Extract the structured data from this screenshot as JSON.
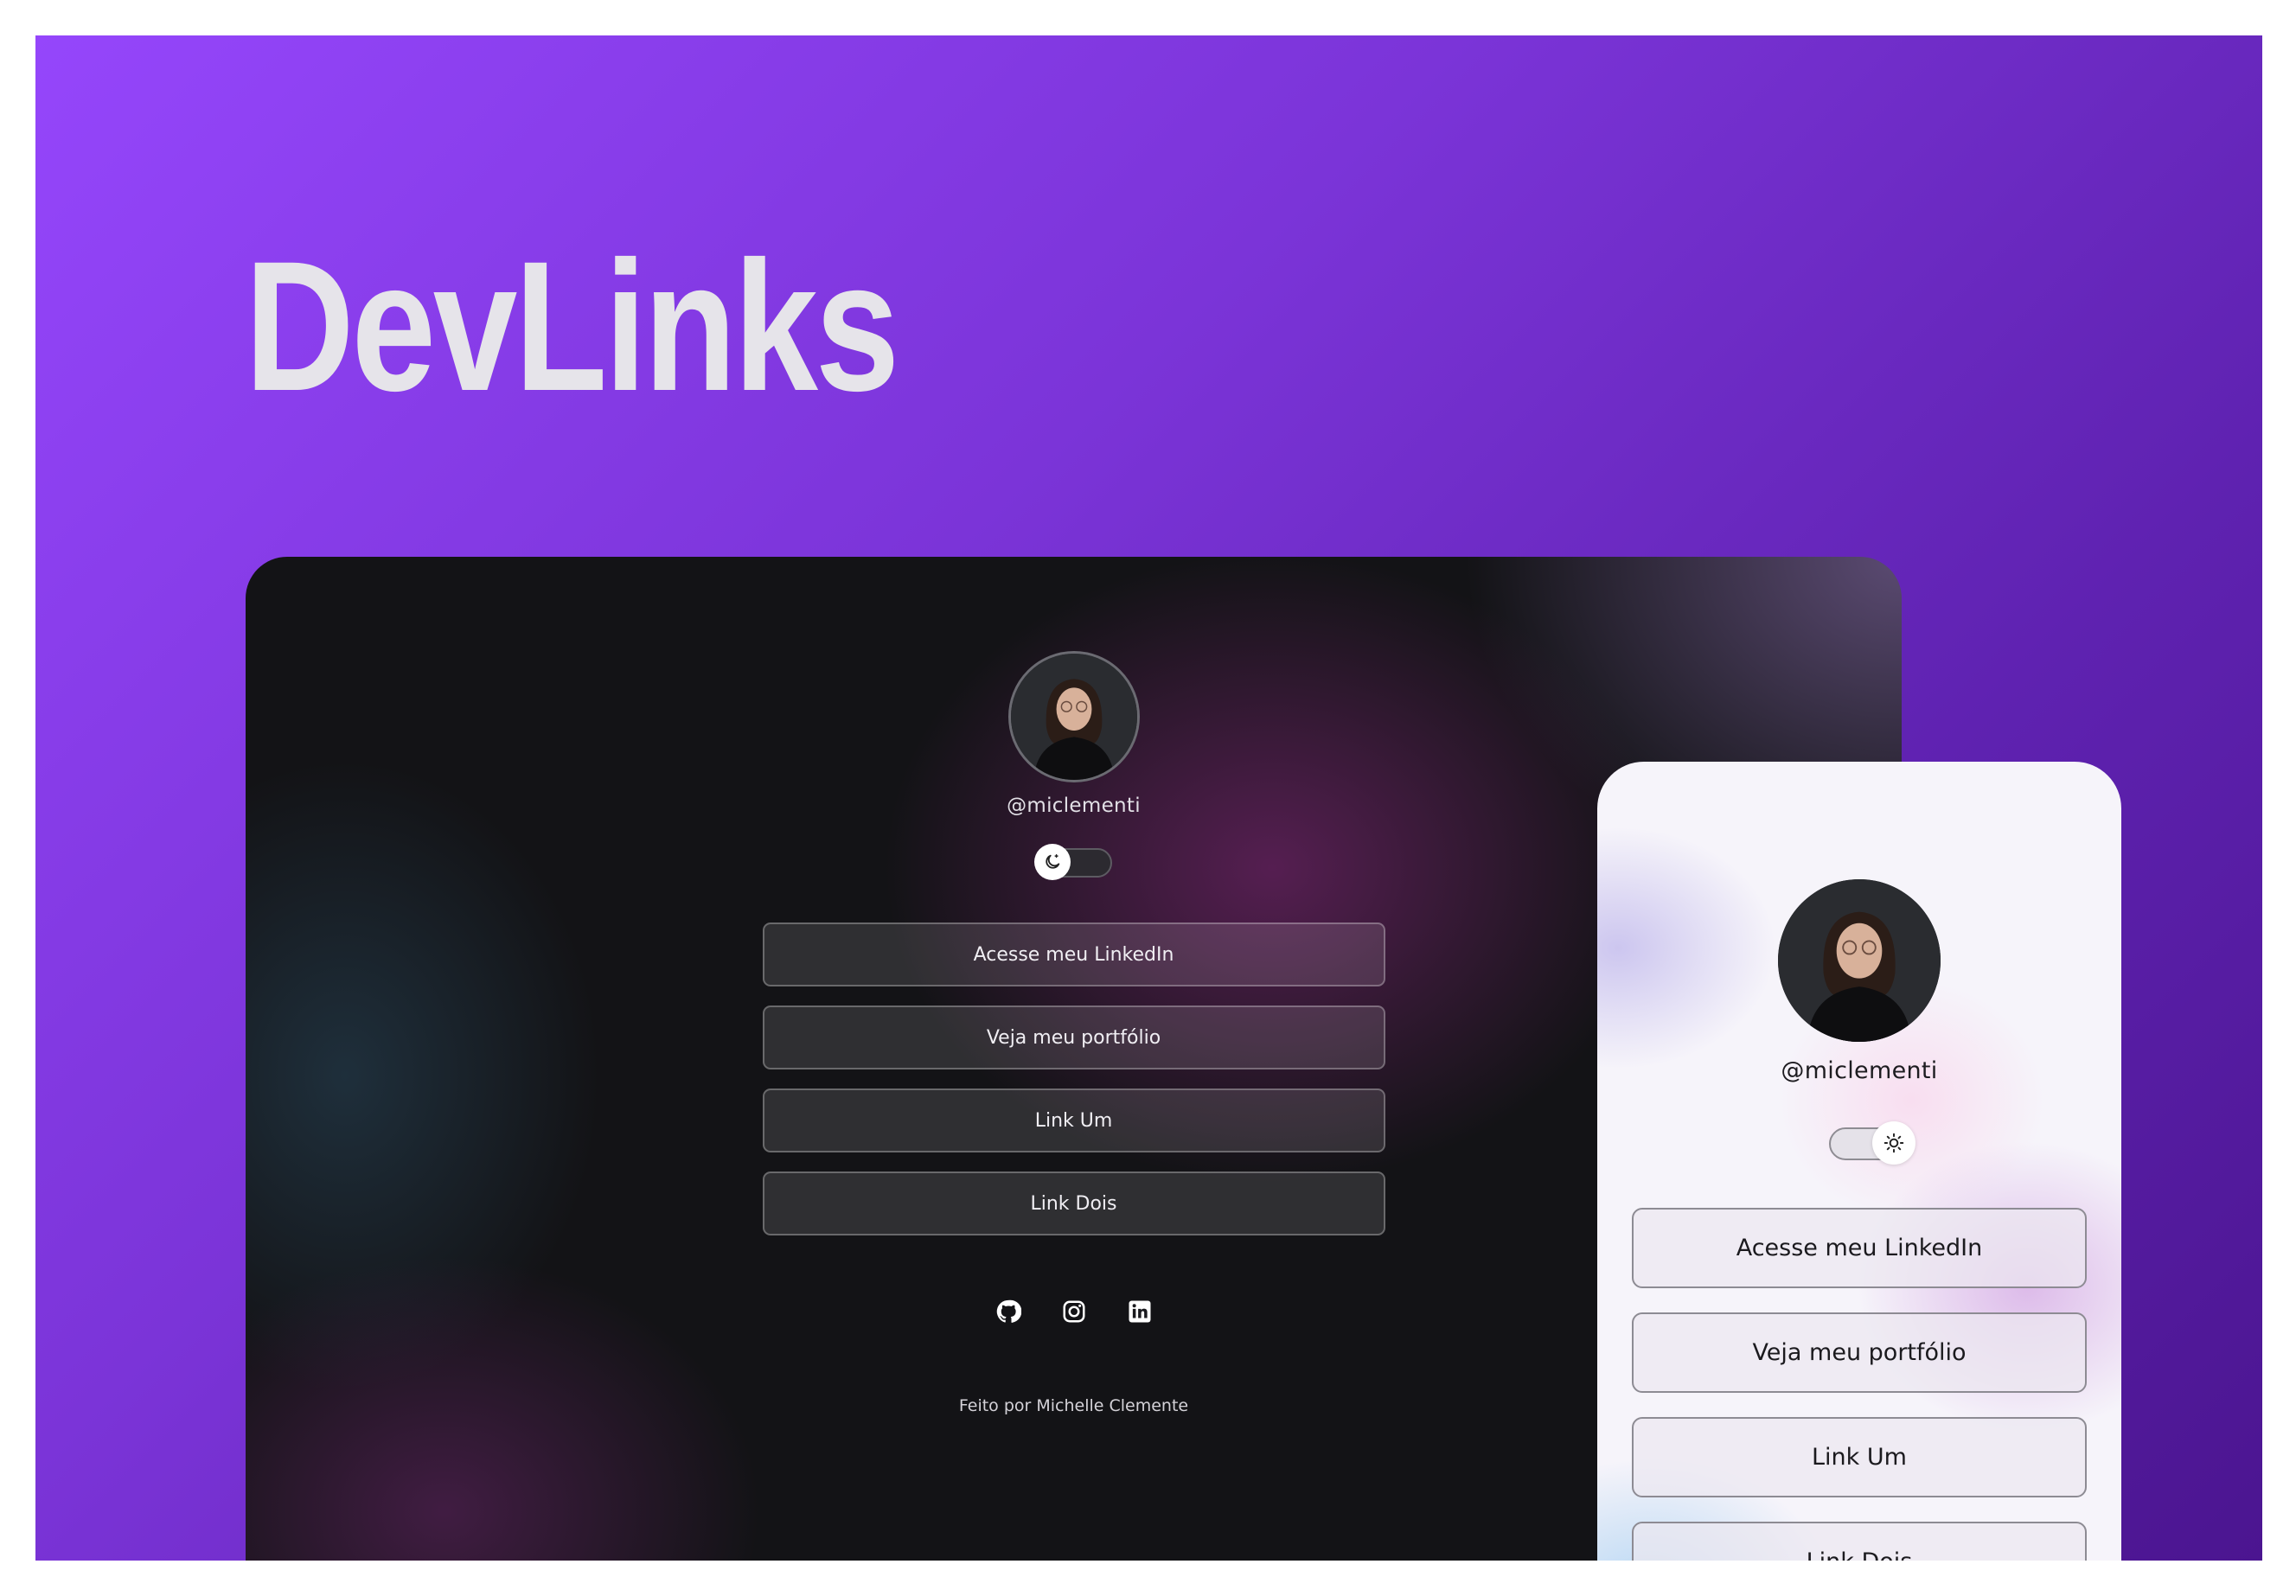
{
  "brand": {
    "title": "DevLinks"
  },
  "colors": {
    "background_accent": "#9546fb",
    "background_deep": "#4b1590"
  },
  "desktop_preview": {
    "theme": "dark",
    "avatar_icon": "profile-photo",
    "handle": "@miclementi",
    "toggle_icon": "moon-icon",
    "links": [
      {
        "label": "Acesse meu LinkedIn"
      },
      {
        "label": "Veja meu portfólio"
      },
      {
        "label": "Link Um"
      },
      {
        "label": "Link Dois"
      }
    ],
    "socials": [
      "github-icon",
      "instagram-icon",
      "linkedin-icon"
    ],
    "footer": "Feito por Michelle Clemente"
  },
  "mobile_preview": {
    "theme": "light",
    "avatar_icon": "profile-photo",
    "handle": "@miclementi",
    "toggle_icon": "sun-icon",
    "links": [
      {
        "label": "Acesse meu LinkedIn"
      },
      {
        "label": "Veja meu portfólio"
      },
      {
        "label": "Link Um"
      },
      {
        "label": "Link Dois"
      }
    ]
  }
}
